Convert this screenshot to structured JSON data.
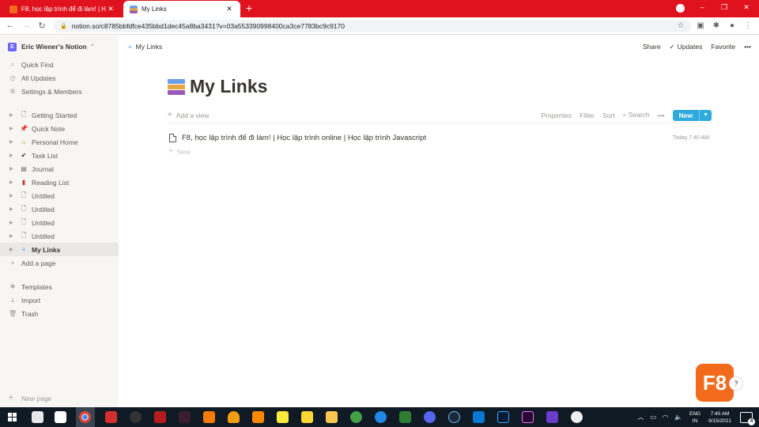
{
  "browser": {
    "tabs": [
      {
        "title": "F8, học lập trình để đi làm! | Học",
        "active": false
      },
      {
        "title": "My Links",
        "active": true
      }
    ],
    "new_tab_symbol": "+",
    "url": "notion.so/c8785bbfdfce435bbd1dec45a8ba3431?v=03a553390998400ca3ce7783bc9c9170"
  },
  "sidebar": {
    "workspace_name": "Eric Wiener's Notion",
    "workspace_initial": "E",
    "top_items": [
      {
        "label": "Quick Find",
        "icon": "search-icon"
      },
      {
        "label": "All Updates",
        "icon": "clock-icon"
      },
      {
        "label": "Settings & Members",
        "icon": "gear-icon"
      }
    ],
    "pages": [
      {
        "label": "Getting Started",
        "icon": "doc-icon"
      },
      {
        "label": "Quick Note",
        "icon": "pin-icon"
      },
      {
        "label": "Personal Home",
        "icon": "house-icon"
      },
      {
        "label": "Task List",
        "icon": "check-icon"
      },
      {
        "label": "Journal",
        "icon": "notebook-icon"
      },
      {
        "label": "Reading List",
        "icon": "book-icon"
      },
      {
        "label": "Untitled",
        "icon": "doc-icon"
      },
      {
        "label": "Untitled",
        "icon": "doc-icon"
      },
      {
        "label": "Untitled",
        "icon": "doc-icon"
      },
      {
        "label": "Untitled",
        "icon": "doc-icon"
      },
      {
        "label": "My Links",
        "icon": "books-icon",
        "active": true
      }
    ],
    "add_page_label": "Add a page",
    "bottom_items": [
      {
        "label": "Templates",
        "icon": "templates-icon"
      },
      {
        "label": "Import",
        "icon": "download-icon"
      },
      {
        "label": "Trash",
        "icon": "trash-icon"
      }
    ],
    "new_page_label": "New page"
  },
  "topbar": {
    "breadcrumb": "My Links",
    "share_label": "Share",
    "updates_label": "Updates",
    "favorite_label": "Favorite",
    "more_symbol": "•••"
  },
  "page": {
    "title": "My Links",
    "title_icon": "books-icon",
    "database": {
      "add_view_label": "Add a view",
      "properties_label": "Properties",
      "filter_label": "Filter",
      "sort_label": "Sort",
      "search_label": "Search",
      "more_symbol": "•••",
      "new_button_label": "New",
      "rows": [
        {
          "title": "F8, học lập trình để đi làm! | Học lập trình online | Học lập trình Javascript",
          "date": "Today 7:40 AM"
        }
      ],
      "new_row_label": "New"
    }
  },
  "overlay": {
    "badge_text": "F8",
    "help_symbol": "?"
  },
  "taskbar": {
    "lang_line1": "ENG",
    "lang_line2": "IN",
    "time": "7:40 AM",
    "date": "9/15/2021",
    "notification_count": "4"
  },
  "colors": {
    "chrome_red": "#e0121e",
    "notion_blue": "#2eaadc",
    "f8_orange": "#f26a1b",
    "sidebar_bg": "#f7f6f3"
  }
}
